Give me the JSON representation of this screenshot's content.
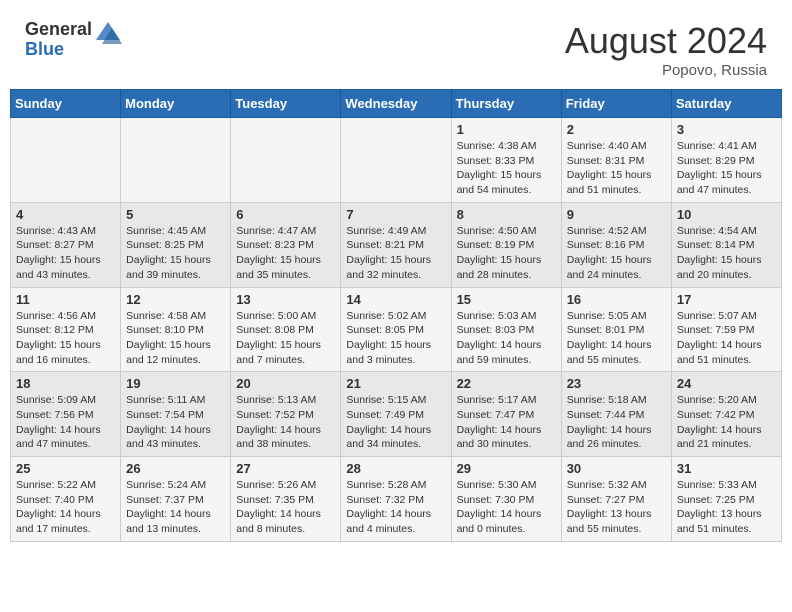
{
  "header": {
    "logo_general": "General",
    "logo_blue": "Blue",
    "month_year": "August 2024",
    "location": "Popovo, Russia"
  },
  "weekdays": [
    "Sunday",
    "Monday",
    "Tuesday",
    "Wednesday",
    "Thursday",
    "Friday",
    "Saturday"
  ],
  "weeks": [
    [
      {
        "day": "",
        "info": ""
      },
      {
        "day": "",
        "info": ""
      },
      {
        "day": "",
        "info": ""
      },
      {
        "day": "",
        "info": ""
      },
      {
        "day": "1",
        "info": "Sunrise: 4:38 AM\nSunset: 8:33 PM\nDaylight: 15 hours\nand 54 minutes."
      },
      {
        "day": "2",
        "info": "Sunrise: 4:40 AM\nSunset: 8:31 PM\nDaylight: 15 hours\nand 51 minutes."
      },
      {
        "day": "3",
        "info": "Sunrise: 4:41 AM\nSunset: 8:29 PM\nDaylight: 15 hours\nand 47 minutes."
      }
    ],
    [
      {
        "day": "4",
        "info": "Sunrise: 4:43 AM\nSunset: 8:27 PM\nDaylight: 15 hours\nand 43 minutes."
      },
      {
        "day": "5",
        "info": "Sunrise: 4:45 AM\nSunset: 8:25 PM\nDaylight: 15 hours\nand 39 minutes."
      },
      {
        "day": "6",
        "info": "Sunrise: 4:47 AM\nSunset: 8:23 PM\nDaylight: 15 hours\nand 35 minutes."
      },
      {
        "day": "7",
        "info": "Sunrise: 4:49 AM\nSunset: 8:21 PM\nDaylight: 15 hours\nand 32 minutes."
      },
      {
        "day": "8",
        "info": "Sunrise: 4:50 AM\nSunset: 8:19 PM\nDaylight: 15 hours\nand 28 minutes."
      },
      {
        "day": "9",
        "info": "Sunrise: 4:52 AM\nSunset: 8:16 PM\nDaylight: 15 hours\nand 24 minutes."
      },
      {
        "day": "10",
        "info": "Sunrise: 4:54 AM\nSunset: 8:14 PM\nDaylight: 15 hours\nand 20 minutes."
      }
    ],
    [
      {
        "day": "11",
        "info": "Sunrise: 4:56 AM\nSunset: 8:12 PM\nDaylight: 15 hours\nand 16 minutes."
      },
      {
        "day": "12",
        "info": "Sunrise: 4:58 AM\nSunset: 8:10 PM\nDaylight: 15 hours\nand 12 minutes."
      },
      {
        "day": "13",
        "info": "Sunrise: 5:00 AM\nSunset: 8:08 PM\nDaylight: 15 hours\nand 7 minutes."
      },
      {
        "day": "14",
        "info": "Sunrise: 5:02 AM\nSunset: 8:05 PM\nDaylight: 15 hours\nand 3 minutes."
      },
      {
        "day": "15",
        "info": "Sunrise: 5:03 AM\nSunset: 8:03 PM\nDaylight: 14 hours\nand 59 minutes."
      },
      {
        "day": "16",
        "info": "Sunrise: 5:05 AM\nSunset: 8:01 PM\nDaylight: 14 hours\nand 55 minutes."
      },
      {
        "day": "17",
        "info": "Sunrise: 5:07 AM\nSunset: 7:59 PM\nDaylight: 14 hours\nand 51 minutes."
      }
    ],
    [
      {
        "day": "18",
        "info": "Sunrise: 5:09 AM\nSunset: 7:56 PM\nDaylight: 14 hours\nand 47 minutes."
      },
      {
        "day": "19",
        "info": "Sunrise: 5:11 AM\nSunset: 7:54 PM\nDaylight: 14 hours\nand 43 minutes."
      },
      {
        "day": "20",
        "info": "Sunrise: 5:13 AM\nSunset: 7:52 PM\nDaylight: 14 hours\nand 38 minutes."
      },
      {
        "day": "21",
        "info": "Sunrise: 5:15 AM\nSunset: 7:49 PM\nDaylight: 14 hours\nand 34 minutes."
      },
      {
        "day": "22",
        "info": "Sunrise: 5:17 AM\nSunset: 7:47 PM\nDaylight: 14 hours\nand 30 minutes."
      },
      {
        "day": "23",
        "info": "Sunrise: 5:18 AM\nSunset: 7:44 PM\nDaylight: 14 hours\nand 26 minutes."
      },
      {
        "day": "24",
        "info": "Sunrise: 5:20 AM\nSunset: 7:42 PM\nDaylight: 14 hours\nand 21 minutes."
      }
    ],
    [
      {
        "day": "25",
        "info": "Sunrise: 5:22 AM\nSunset: 7:40 PM\nDaylight: 14 hours\nand 17 minutes."
      },
      {
        "day": "26",
        "info": "Sunrise: 5:24 AM\nSunset: 7:37 PM\nDaylight: 14 hours\nand 13 minutes."
      },
      {
        "day": "27",
        "info": "Sunrise: 5:26 AM\nSunset: 7:35 PM\nDaylight: 14 hours\nand 8 minutes."
      },
      {
        "day": "28",
        "info": "Sunrise: 5:28 AM\nSunset: 7:32 PM\nDaylight: 14 hours\nand 4 minutes."
      },
      {
        "day": "29",
        "info": "Sunrise: 5:30 AM\nSunset: 7:30 PM\nDaylight: 14 hours\nand 0 minutes."
      },
      {
        "day": "30",
        "info": "Sunrise: 5:32 AM\nSunset: 7:27 PM\nDaylight: 13 hours\nand 55 minutes."
      },
      {
        "day": "31",
        "info": "Sunrise: 5:33 AM\nSunset: 7:25 PM\nDaylight: 13 hours\nand 51 minutes."
      }
    ]
  ]
}
